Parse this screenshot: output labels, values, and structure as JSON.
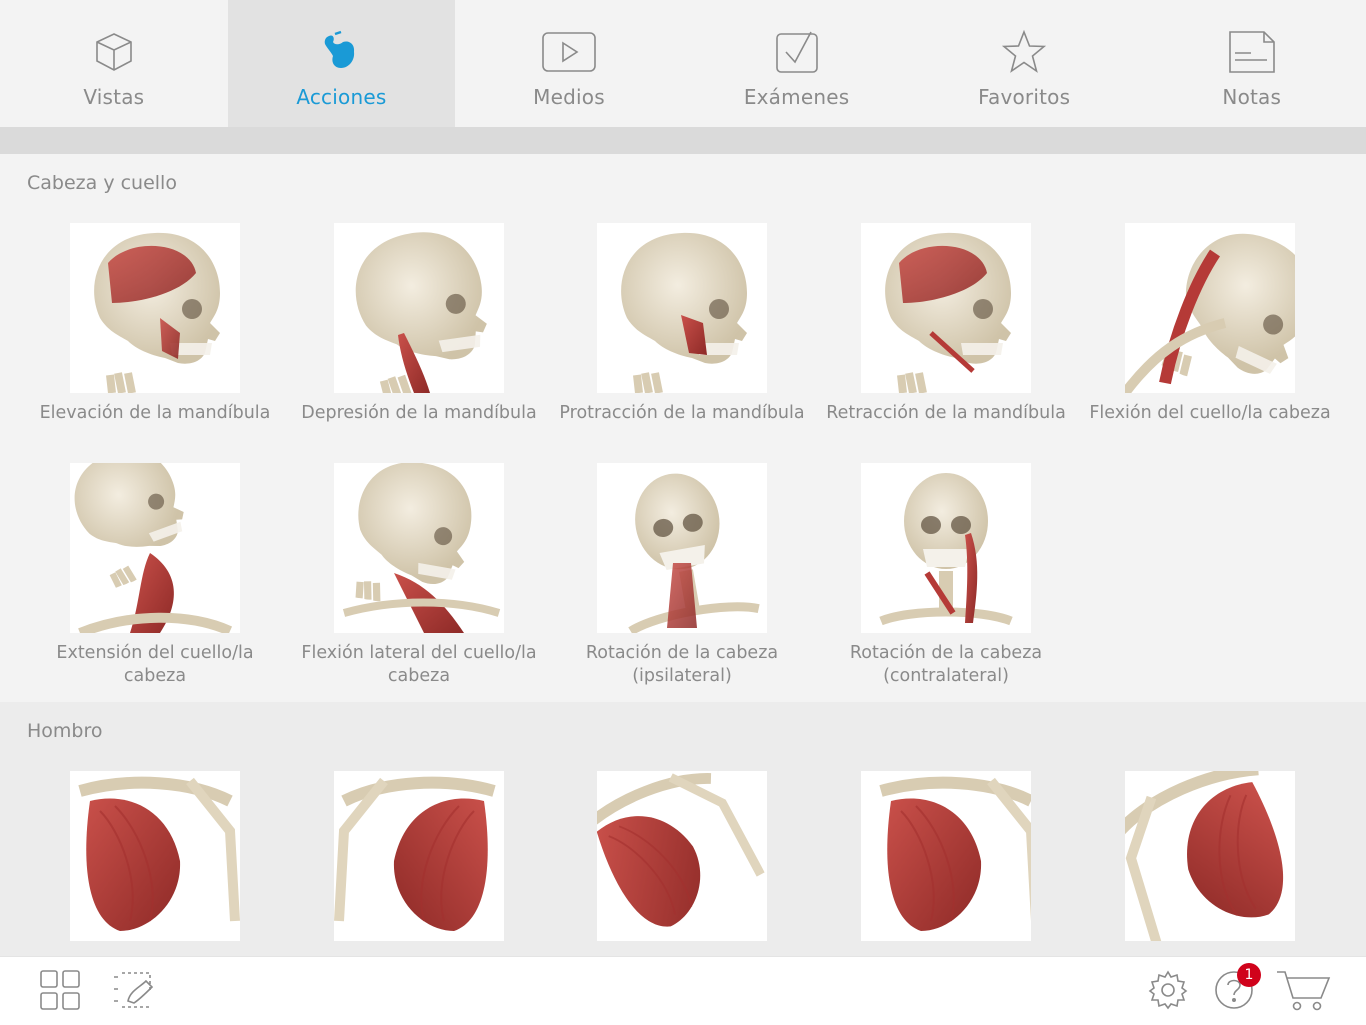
{
  "tabs": [
    {
      "label": "Vistas",
      "icon": "cube-icon",
      "active": false
    },
    {
      "label": "Acciones",
      "icon": "flexing-arm-icon",
      "active": true
    },
    {
      "label": "Medios",
      "icon": "play-icon",
      "active": false
    },
    {
      "label": "Exámenes",
      "icon": "checkbox-icon",
      "active": false
    },
    {
      "label": "Favoritos",
      "icon": "star-icon",
      "active": false
    },
    {
      "label": "Notas",
      "icon": "note-icon",
      "active": false
    }
  ],
  "colors": {
    "accent": "#1a9ad6",
    "badge": "#d0021b",
    "muscle": "#b53a37",
    "bone": "#e6dcc8"
  },
  "sections": [
    {
      "title": "Cabeza y cuello",
      "items": [
        {
          "label": "Elevación de la mandíbula"
        },
        {
          "label": "Depresión de la mandíbula"
        },
        {
          "label": "Protracción de la mandíbula"
        },
        {
          "label": "Retracción de la mandíbula"
        },
        {
          "label": "Flexión del cuello/la cabeza"
        },
        {
          "label": "Extensión del cuello/la cabeza"
        },
        {
          "label": "Flexión lateral del cuello/la cabeza"
        },
        {
          "label": "Rotación de la cabeza (ipsilateral)"
        },
        {
          "label": "Rotación de la cabeza (contralateral)"
        }
      ]
    },
    {
      "title": "Hombro",
      "items": [
        {
          "label": ""
        },
        {
          "label": ""
        },
        {
          "label": ""
        },
        {
          "label": ""
        },
        {
          "label": ""
        }
      ]
    }
  ],
  "bottombar": {
    "left": [
      {
        "icon": "grid-icon"
      },
      {
        "icon": "select-region-icon"
      }
    ],
    "right": [
      {
        "icon": "gear-icon"
      },
      {
        "icon": "help-icon",
        "badge": "1"
      },
      {
        "icon": "cart-icon"
      }
    ]
  }
}
